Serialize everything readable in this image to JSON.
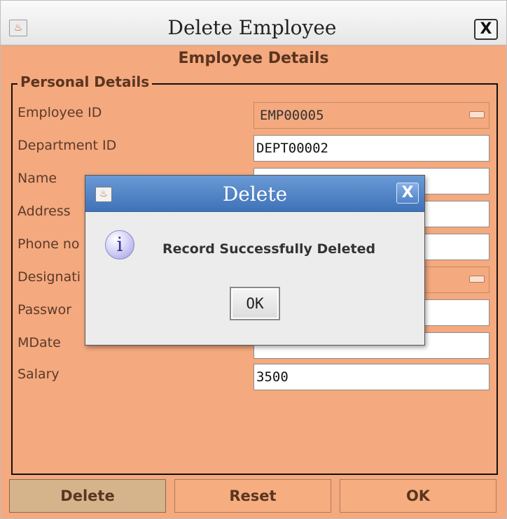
{
  "window": {
    "title": "Delete Employee",
    "close_label": "X",
    "icon": "java-app-icon"
  },
  "form": {
    "section_title": "Employee Details",
    "group_title": "Personal Details",
    "labels": {
      "employee_id": "Employee ID",
      "department_id": "Department ID",
      "name": "Name",
      "address": "Address",
      "phone": "Phone no",
      "designation": "Designati",
      "password": "Passwor",
      "mdate": "MDate",
      "salary": "Salary"
    },
    "values": {
      "employee_id": "EMP00005",
      "department_id": "DEPT00002",
      "salary": "3500"
    }
  },
  "buttons": {
    "delete": "Delete",
    "reset": "Reset",
    "ok": "OK"
  },
  "dialog": {
    "title": "Delete",
    "close_label": "X",
    "icon": "info-icon",
    "icon_glyph": "i",
    "message": "Record Successfully Deleted",
    "ok_label": "OK"
  },
  "colors": {
    "window_bg": "#f4a97e",
    "dialog_title_bg": "#4f82c8"
  }
}
